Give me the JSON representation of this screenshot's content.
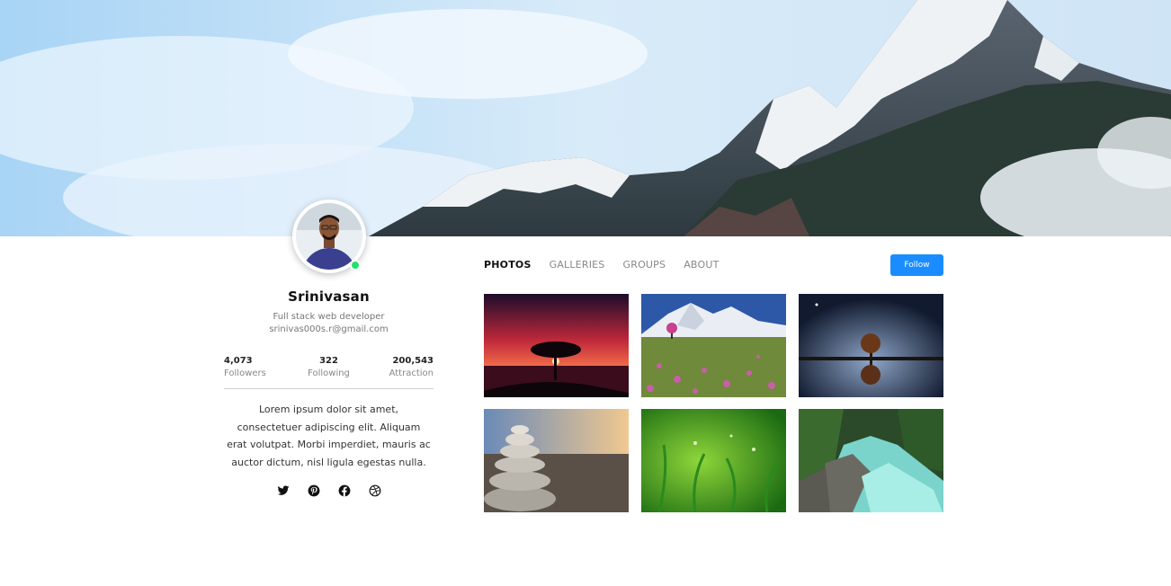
{
  "cover": {
    "icon": "mountain-cover-image"
  },
  "profile": {
    "name": "Srinivasan",
    "role": "Full stack web developer",
    "email": "srinivas000s.r@gmail.com",
    "online_color": "#22e06b",
    "stats": [
      {
        "value": "4,073",
        "label": "Followers"
      },
      {
        "value": "322",
        "label": "Following"
      },
      {
        "value": "200,543",
        "label": "Attraction"
      }
    ],
    "bio": "Lorem ipsum dolor sit amet, consectetuer adipiscing elit. Aliquam erat volutpat. Morbi imperdiet, mauris ac auctor dictum, nisl ligula egestas nulla.",
    "socials": [
      "twitter-icon",
      "pinterest-icon",
      "facebook-icon",
      "dribbble-icon"
    ]
  },
  "tabs": [
    {
      "label": "PHOTOS",
      "active": true
    },
    {
      "label": "GALLERIES",
      "active": false
    },
    {
      "label": "GROUPS",
      "active": false
    },
    {
      "label": "ABOUT",
      "active": false
    }
  ],
  "follow_button": {
    "label": "Follow",
    "color": "#1a8cff"
  },
  "photos": [
    "sunset-tree-photo",
    "mountain-meadow-photo",
    "night-tree-reflection-photo",
    "stacked-stones-photo",
    "green-grass-photo",
    "forest-river-photo"
  ]
}
